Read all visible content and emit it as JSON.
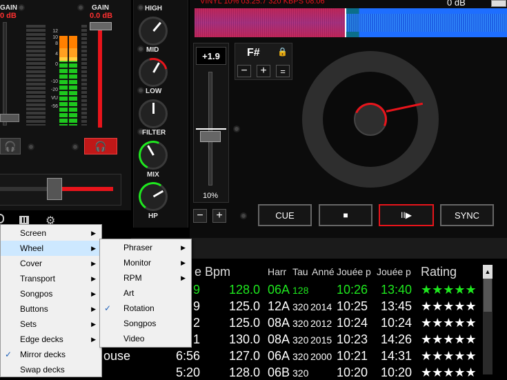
{
  "mixer": {
    "gain_left_label": "GAIN",
    "gain_left_value": "0 dB",
    "gain_right_label": "GAIN",
    "gain_right_value": "0.0 dB",
    "meter_scale": [
      "12",
      "10",
      "8",
      "4",
      "0",
      "-10",
      "-20",
      "VU",
      "-56"
    ],
    "eq": {
      "high": "HIGH",
      "mid": "MID",
      "low": "LOW",
      "filter": "FILTER",
      "mix": "MIX",
      "hp": "HP"
    }
  },
  "deck": {
    "waveform_info": "VINYL  10%  03:25.7 320 KBPS  08:06",
    "gain_readout": "0 dB",
    "pitch_value": "+1.9",
    "pitch_range": "10%",
    "key": "F#",
    "cue_label": "CUE",
    "sync_label": "SYNC",
    "play_pause_glyph": "II▶",
    "stop_glyph": "■",
    "minus": "−",
    "plus": "+",
    "equals": "="
  },
  "table": {
    "headers": [
      "e Bpm",
      "Harr",
      "Tau",
      "Anné",
      "Jouée p",
      "Jouée p",
      "Rating"
    ],
    "rows": [
      {
        "title": "",
        "len": "9",
        "bpm": "128.0",
        "key": "06A",
        "bitrate": "128",
        "year": "",
        "played": "10:26",
        "added": "13:40",
        "stars": "★★★★★",
        "highlight": true
      },
      {
        "title": "",
        "len": "9",
        "bpm": "125.0",
        "key": "12A",
        "bitrate": "320",
        "year": "2014",
        "played": "10:25",
        "added": "13:45",
        "stars": "★★★★★",
        "highlight": false
      },
      {
        "title": "",
        "len": "2",
        "bpm": "125.0",
        "key": "08A",
        "bitrate": "320",
        "year": "2012",
        "played": "10:24",
        "added": "10:24",
        "stars": "★★★★★",
        "highlight": false
      },
      {
        "title": "",
        "len": "1",
        "bpm": "130.0",
        "key": "08A",
        "bitrate": "320",
        "year": "2015",
        "played": "10:23",
        "added": "14:26",
        "stars": "★★★★★",
        "highlight": false
      },
      {
        "title": "ouse",
        "len": "6:56",
        "bpm": "127.0",
        "key": "06A",
        "bitrate": "320",
        "year": "2000",
        "played": "10:21",
        "added": "14:31",
        "stars": "★★★★★",
        "highlight": false
      },
      {
        "title": "",
        "len": "5:20",
        "bpm": "128.0",
        "key": "06B",
        "bitrate": "320",
        "year": "",
        "played": "10:20",
        "added": "10:20",
        "stars": "★★★★★",
        "highlight": false
      }
    ]
  },
  "menu_main": [
    {
      "label": "Screen",
      "arrow": "▶",
      "check": "",
      "selected": false
    },
    {
      "label": "Wheel",
      "arrow": "▶",
      "check": "",
      "selected": true
    },
    {
      "label": "Cover",
      "arrow": "▶",
      "check": "",
      "selected": false
    },
    {
      "label": "Transport",
      "arrow": "▶",
      "check": "",
      "selected": false
    },
    {
      "label": "Songpos",
      "arrow": "▶",
      "check": "",
      "selected": false
    },
    {
      "label": "Buttons",
      "arrow": "▶",
      "check": "",
      "selected": false
    },
    {
      "label": "Sets",
      "arrow": "▶",
      "check": "",
      "selected": false
    },
    {
      "label": "Edge decks",
      "arrow": "▶",
      "check": "",
      "selected": false
    },
    {
      "label": "Mirror decks",
      "arrow": "",
      "check": "✓",
      "selected": false
    },
    {
      "label": "Swap decks",
      "arrow": "",
      "check": "",
      "selected": false
    }
  ],
  "menu_wheel": [
    {
      "label": "Phraser",
      "arrow": "▶",
      "check": ""
    },
    {
      "label": "Monitor",
      "arrow": "▶",
      "check": ""
    },
    {
      "label": "RPM",
      "arrow": "▶",
      "check": ""
    },
    {
      "label": "Art",
      "arrow": "",
      "check": ""
    },
    {
      "label": "Rotation",
      "arrow": "",
      "check": "✓"
    },
    {
      "label": "Songpos",
      "arrow": "",
      "check": ""
    },
    {
      "label": "Video",
      "arrow": "",
      "check": ""
    }
  ],
  "colors": {
    "accent_red": "#e8141b",
    "accent_green": "#1ee81e",
    "waveform_blue": "#1e6eff",
    "waveform_purple": "#9a3c9a"
  }
}
